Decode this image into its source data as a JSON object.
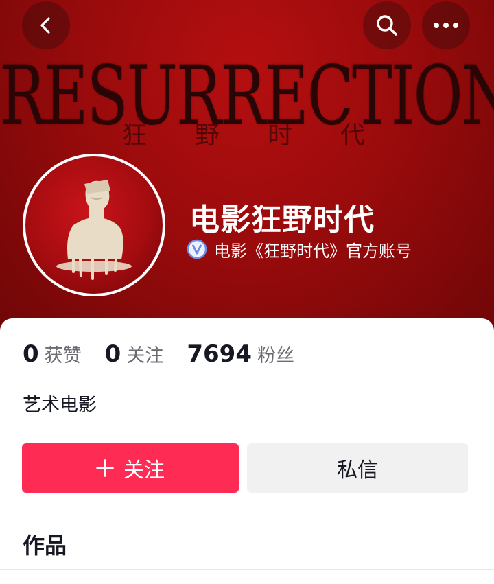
{
  "banner": {
    "title": "RESURRECTION",
    "subtitle": "狂野时代"
  },
  "top_bar": {
    "back_icon": "chevron-left-icon",
    "search_icon": "search-icon",
    "more_icon": "more-horizontal-icon"
  },
  "profile": {
    "name": "电影狂野时代",
    "verified_icon": "verified-badge-icon",
    "verified_text": "电影《狂野时代》官方账号"
  },
  "stats": [
    {
      "value": "0",
      "label": "获赞"
    },
    {
      "value": "0",
      "label": "关注"
    },
    {
      "value": "7694",
      "label": "粉丝"
    }
  ],
  "bio": "艺术电影",
  "actions": {
    "follow_label": "关注",
    "message_label": "私信"
  },
  "tabs": {
    "works_label": "作品"
  },
  "colors": {
    "banner_red": "#9a0b0c",
    "follow_pink": "#fe2c55",
    "message_gray": "#f1f1f2",
    "verify_blue": "#6f8ee8"
  }
}
